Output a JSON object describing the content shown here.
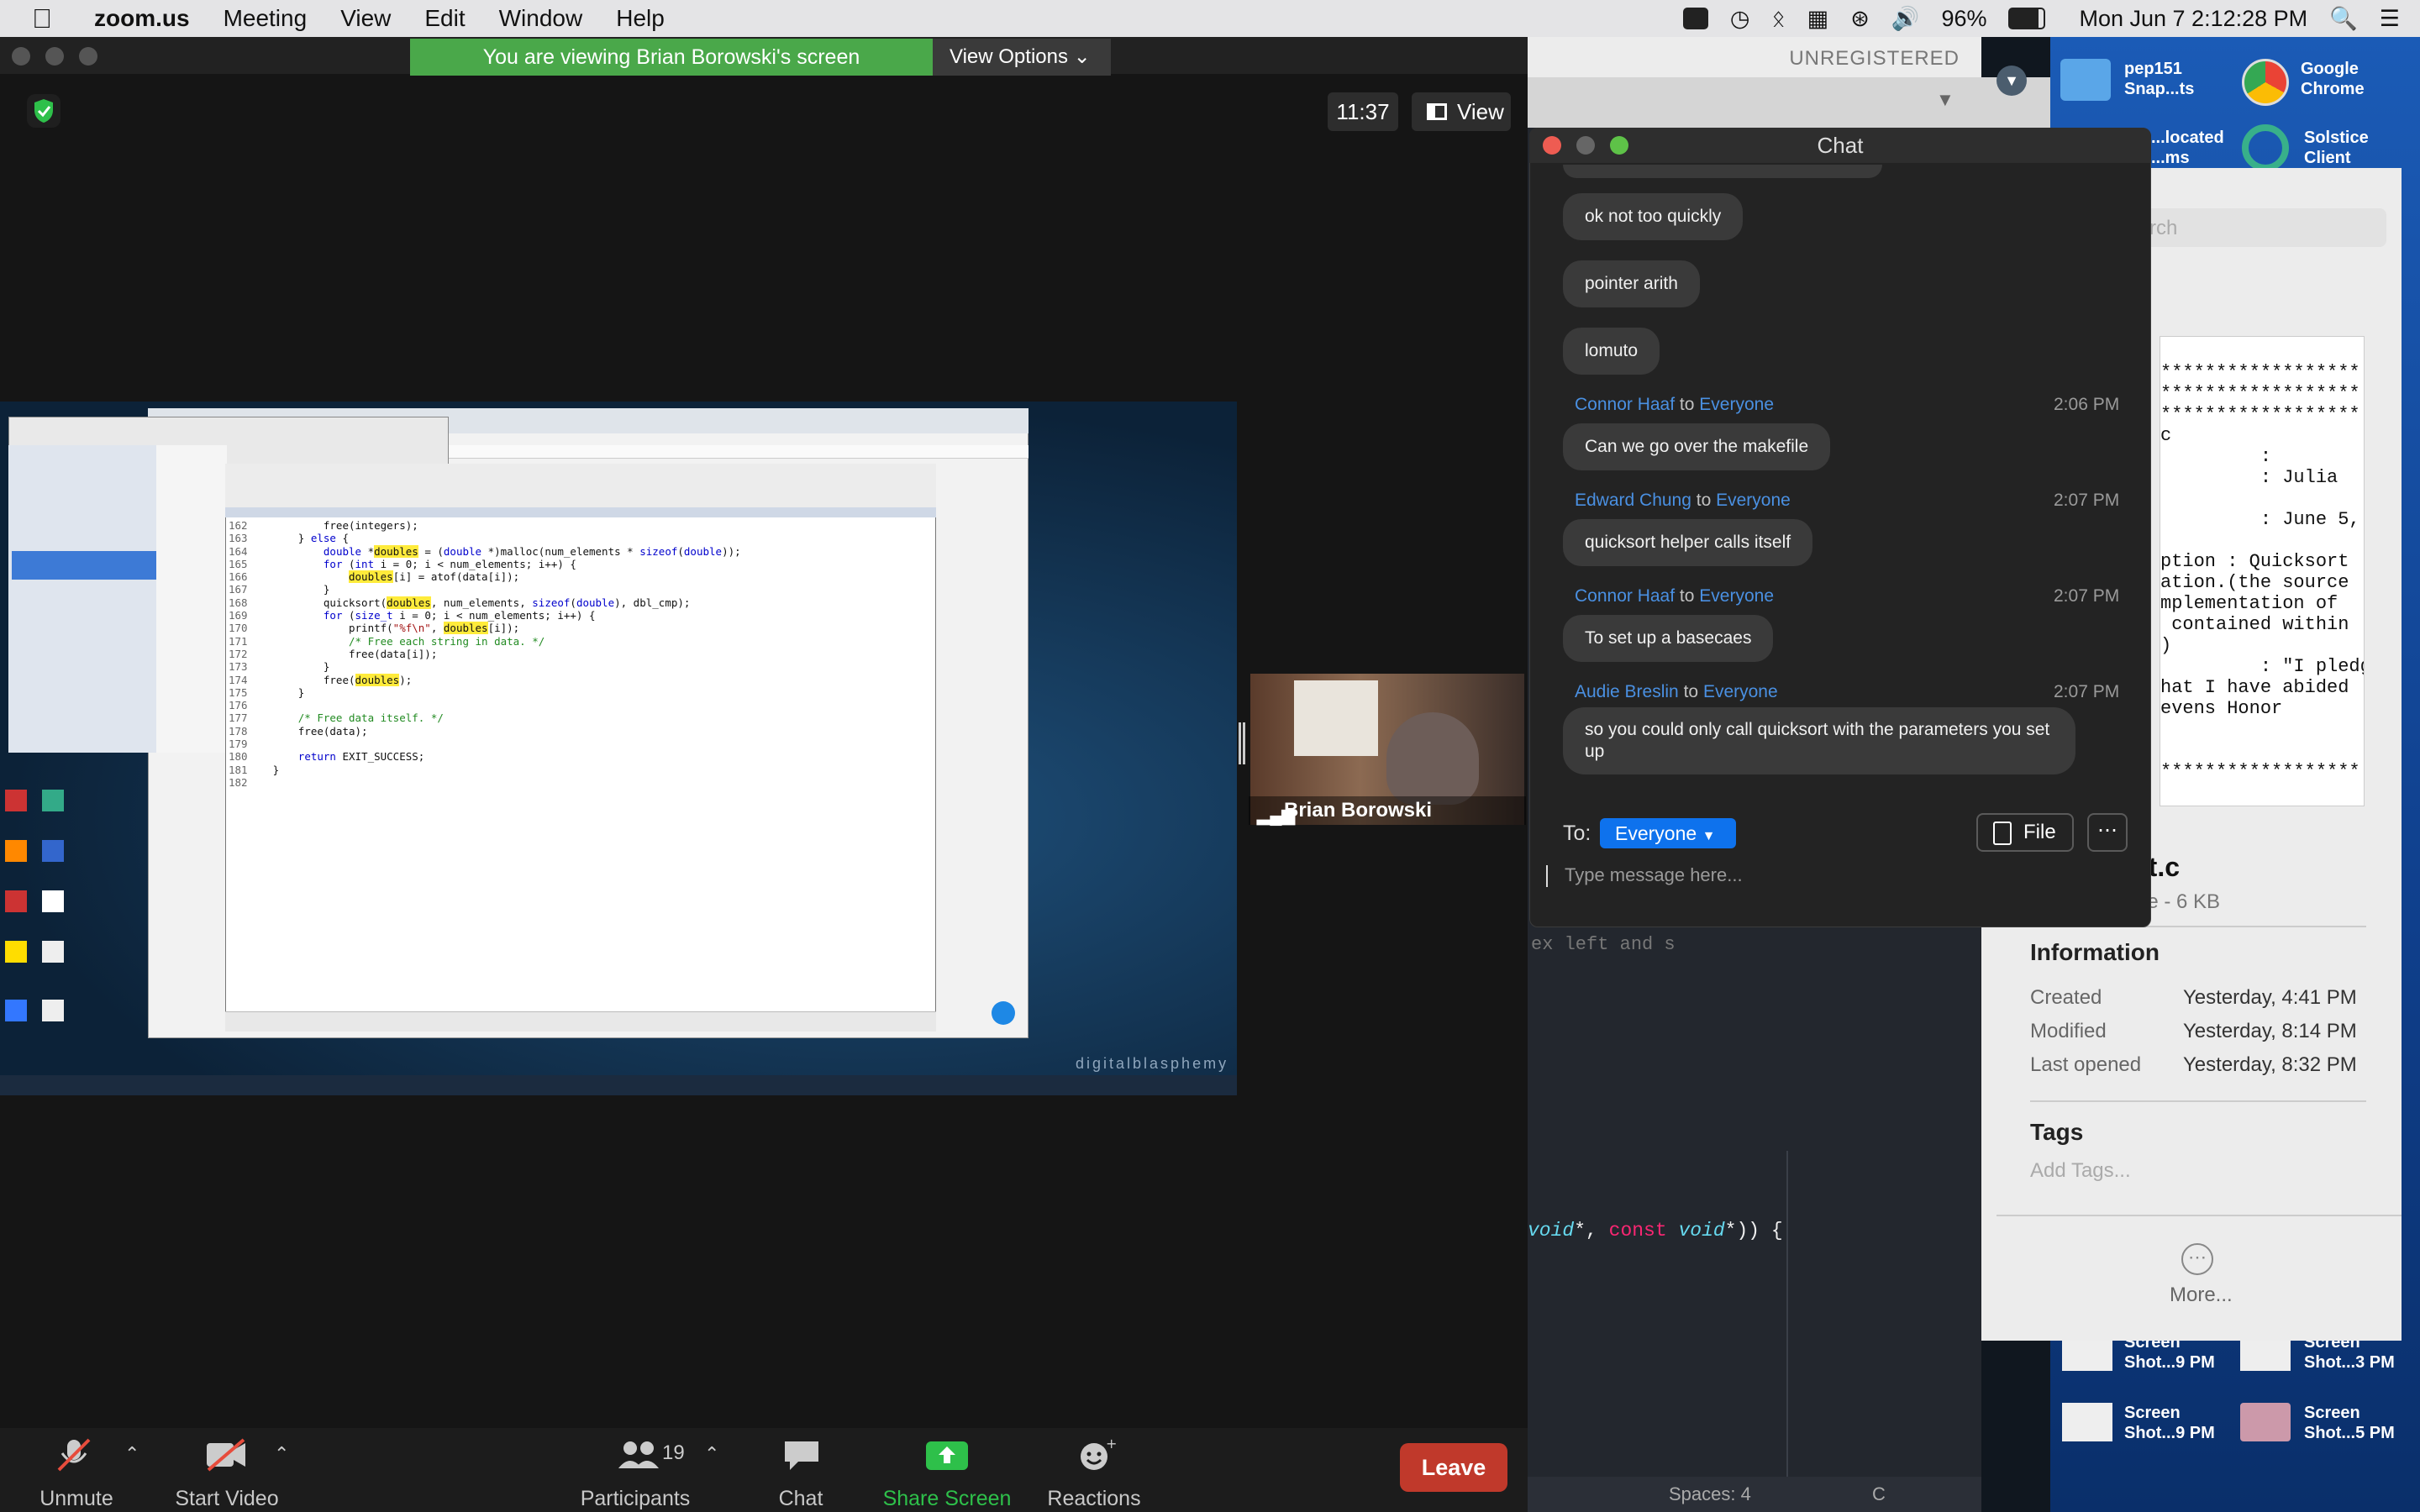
{
  "menubar": {
    "app": "zoom.us",
    "items": [
      "Meeting",
      "View",
      "Edit",
      "Window",
      "Help"
    ],
    "battery": "96%",
    "datetime": "Mon Jun 7  2:12:28 PM"
  },
  "zoom": {
    "banner": "You are viewing Brian Borowski's screen",
    "view_options": "View Options",
    "timer": "11:37",
    "view_label": "View",
    "speaker_name": "Brian Borowski",
    "watermark": "digitalblasphemy",
    "toolbar": {
      "unmute": "Unmute",
      "start_video": "Start Video",
      "participants": "Participants",
      "participants_count": "19",
      "chat": "Chat",
      "share_screen": "Share Screen",
      "reactions": "Reactions",
      "leave": "Leave"
    }
  },
  "shared_code": {
    "lines": [
      {
        "n": "162",
        "t": "            free(integers);"
      },
      {
        "n": "163",
        "t": "        } else {"
      },
      {
        "n": "164",
        "t": "            double *doubles = (double *)malloc(num_elements * sizeof(double));"
      },
      {
        "n": "165",
        "t": "            for (int i = 0; i < num_elements; i++) {"
      },
      {
        "n": "166",
        "t": "                doubles[i] = atof(data[i]);"
      },
      {
        "n": "167",
        "t": "            }"
      },
      {
        "n": "168",
        "t": "            quicksort(doubles, num_elements, sizeof(double), dbl_cmp);"
      },
      {
        "n": "169",
        "t": "            for (size_t i = 0; i < num_elements; i++) {"
      },
      {
        "n": "170",
        "t": "                printf(\"%f\\n\", doubles[i]);"
      },
      {
        "n": "171",
        "t": "                /* Free each string in data. */"
      },
      {
        "n": "172",
        "t": "                free(data[i]);"
      },
      {
        "n": "173",
        "t": "            }"
      },
      {
        "n": "174",
        "t": "            free(doubles);"
      },
      {
        "n": "175",
        "t": "        }"
      },
      {
        "n": "176",
        "t": ""
      },
      {
        "n": "177",
        "t": "        /* Free data itself. */"
      },
      {
        "n": "178",
        "t": "        free(data);"
      },
      {
        "n": "179",
        "t": ""
      },
      {
        "n": "180",
        "t": "        return EXIT_SUCCESS;"
      },
      {
        "n": "181",
        "t": "    }"
      },
      {
        "n": "182",
        "t": ""
      }
    ]
  },
  "chat": {
    "title": "Chat",
    "messages": [
      {
        "sender": "",
        "to": "",
        "time": "",
        "text": "ok not too quickly"
      },
      {
        "sender": "",
        "to": "",
        "time": "",
        "text": "pointer arith"
      },
      {
        "sender": "",
        "to": "",
        "time": "",
        "text": "lomuto"
      },
      {
        "sender": "Connor Haaf",
        "to": "Everyone",
        "time": "2:06 PM",
        "text": "Can we go over the makefile"
      },
      {
        "sender": "Edward Chung",
        "to": "Everyone",
        "time": "2:07 PM",
        "text": "quicksort helper calls itself"
      },
      {
        "sender": "Connor Haaf",
        "to": "Everyone",
        "time": "2:07 PM",
        "text": "To set up a basecaes"
      },
      {
        "sender": "Audie Breslin",
        "to": "Everyone",
        "time": "2:07 PM",
        "text": "so you could only call quicksort with the parameters you set up"
      }
    ],
    "to_word": "to",
    "to_label": "To:",
    "recipient": "Everyone",
    "file_button": "File",
    "input_placeholder": "Type message here..."
  },
  "editor": {
    "title": "UNREGISTERED",
    "line_a": "ex left and s",
    "line_b_1": "void",
    "line_b_2": "*, ",
    "line_b_3": "const",
    "line_b_4": " void",
    "line_b_5": "*)) {",
    "status_spaces": "Spaces: 4",
    "status_lang": "C"
  },
  "desktop": {
    "icon1": "pep151\nSnap...ts",
    "icon2": "Google\nChrome",
    "icon3": "...located\n...ms",
    "icon4": "Solstice\nClient",
    "shot1": "Screen\nShot...9 PM",
    "shot2": "Screen\nShot...3 PM",
    "shot3": "Screen\nShot...9 PM",
    "shot4": "Screen\nShot...5 PM"
  },
  "finder": {
    "search_placeholder": "...rch",
    "doc_lines": [
      "******************",
      "******************",
      "******************",
      "c",
      "         :",
      "         : Julia",
      "",
      "         : June 5,",
      "",
      "ption : Quicksort",
      "ation.(the source",
      "mplementation of",
      " contained within",
      ")",
      "         : \"I pledge",
      "hat I have abided",
      "evens Honor",
      "",
      "",
      "******************"
    ],
    "filename": "...t.c",
    "filesize": "...le - 6 KB",
    "info_heading": "Information",
    "created_label": "Created",
    "created": "Yesterday, 4:41 PM",
    "modified_label": "Modified",
    "modified": "Yesterday, 8:14 PM",
    "opened_label": "Last opened",
    "opened": "Yesterday, 8:32 PM",
    "tags_heading": "Tags",
    "tags_placeholder": "Add Tags...",
    "more": "More..."
  },
  "colors": {
    "banner_green": "#4aa84a",
    "zoom_blue": "#0e72ed",
    "leave_red": "#c0392b",
    "share_green": "#2ec04a",
    "sender_blue": "#4a90e2"
  }
}
